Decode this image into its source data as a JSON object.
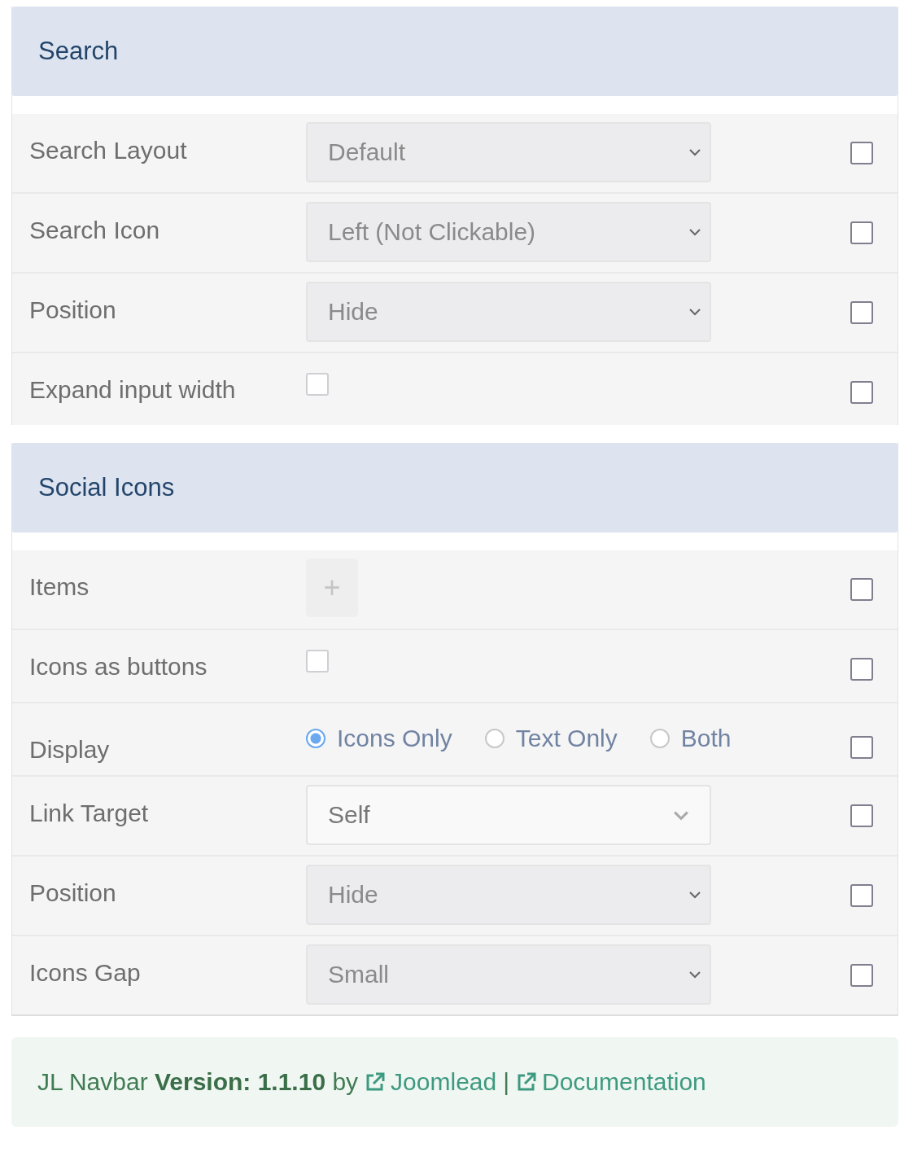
{
  "sections": [
    {
      "title": "Search",
      "rows": [
        {
          "label": "Search Layout",
          "kind": "select",
          "value": "Default",
          "disabled": true,
          "checked": false
        },
        {
          "label": "Search Icon",
          "kind": "select",
          "value": "Left (Not Clickable)",
          "disabled": true,
          "checked": false
        },
        {
          "label": "Position",
          "kind": "select",
          "value": "Hide",
          "disabled": true,
          "checked": false
        },
        {
          "label": "Expand input width",
          "kind": "checkbox",
          "on": false,
          "checked": false
        }
      ]
    },
    {
      "title": "Social Icons",
      "rows": [
        {
          "label": "Items",
          "kind": "add",
          "value": "+",
          "checked": false
        },
        {
          "label": "Icons as buttons",
          "kind": "checkbox",
          "on": false,
          "checked": false
        },
        {
          "label": "Display",
          "kind": "radio",
          "options": [
            {
              "label": "Icons Only",
              "selected": true
            },
            {
              "label": "Text Only",
              "selected": false
            },
            {
              "label": "Both",
              "selected": false
            }
          ],
          "checked": false
        },
        {
          "label": "Link Target",
          "kind": "select",
          "value": "Self",
          "disabled": false,
          "checked": false
        },
        {
          "label": "Position",
          "kind": "select",
          "value": "Hide",
          "disabled": true,
          "checked": false
        },
        {
          "label": "Icons Gap",
          "kind": "select",
          "value": "Small",
          "disabled": true,
          "checked": false
        }
      ]
    }
  ],
  "footer": {
    "text": "JL Navbar **Version: 1.1.10** by",
    "links": [
      {
        "label": "Joomlead"
      },
      {
        "label": "Documentation"
      }
    ],
    "separator": "|"
  }
}
